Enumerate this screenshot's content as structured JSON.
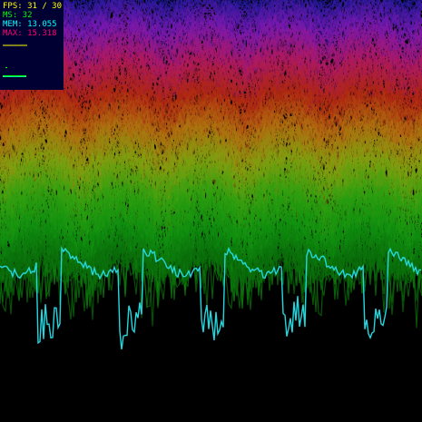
{
  "stats": {
    "fps": "FPS: 31 / 30",
    "ms": "MS: 32",
    "mem": "MEM: 13.055",
    "max": "MAX: 15.318",
    "colors": {
      "fps": "#ffff00",
      "ms": "#00ff00",
      "mem": "#00ffff",
      "max": "#ff0070",
      "panel_bg": "#000033"
    }
  },
  "visualizer": {
    "background": "#000000",
    "highlight_wave_color": "#22d8e0",
    "band_gradient": [
      "#1a1a9a",
      "#7a1ab0",
      "#b01a60",
      "#b02810",
      "#b07010",
      "#80a010",
      "#30a010",
      "#109010",
      "#0a6a0a"
    ]
  }
}
